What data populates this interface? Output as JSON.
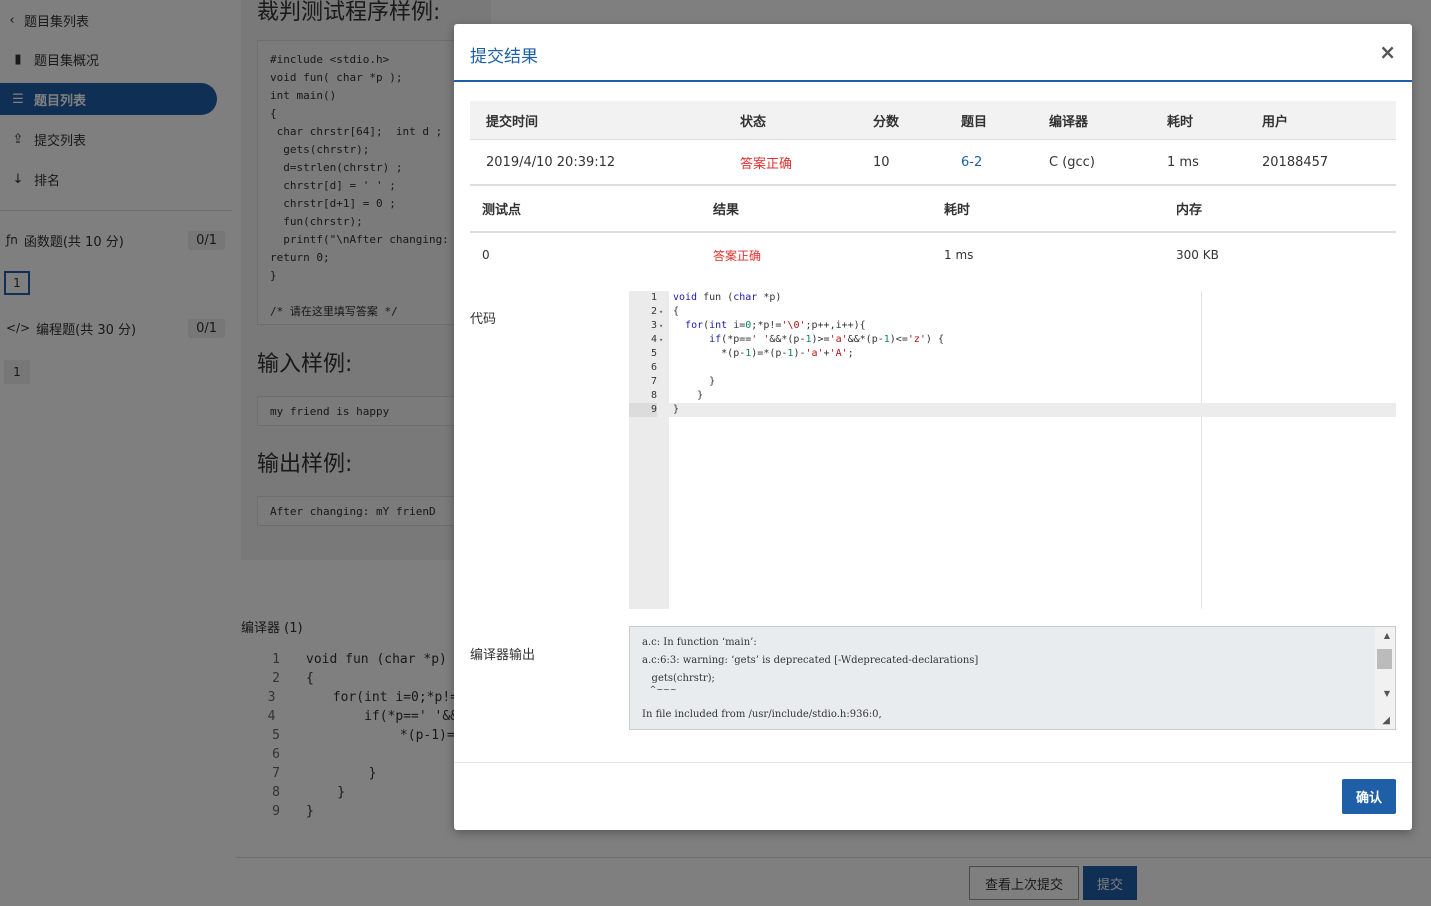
{
  "sidebar": {
    "back_label": "题目集列表",
    "items": [
      {
        "label": "题目集概况",
        "icon": "book-icon"
      },
      {
        "label": "题目列表",
        "icon": "list-icon"
      },
      {
        "label": "提交列表",
        "icon": "upload-icon"
      },
      {
        "label": "排名",
        "icon": "sort-icon"
      }
    ],
    "sections": [
      {
        "label": "函数题(共 10 分)",
        "score": "0/1",
        "questions": [
          "1"
        ]
      },
      {
        "label": "编程题(共 30 分)",
        "score": "0/1",
        "questions": [
          "1"
        ]
      }
    ]
  },
  "problem": {
    "judge_title": "裁判测试程序样例:",
    "judge_code": "#include <stdio.h>\nvoid fun( char *p );\nint main()\n{\n char chrstr[64];  int d ;\n  gets(chrstr);\n  d=strlen(chrstr) ;\n  chrstr[d] = ' ' ;\n  chrstr[d+1] = 0 ;\n  fun(chrstr);\n  printf(\"\\nAfter changing:\nreturn 0;\n}\n\n/* 请在这里填写答案 */",
    "input_title": "输入样例:",
    "input_sample": "my friend is happy",
    "output_title": "输出样例:",
    "output_sample": "After changing:   mY frienD"
  },
  "editor": {
    "label": "编译器 (1)",
    "lines": [
      {
        "n": "1",
        "t": "void fun (char *p)"
      },
      {
        "n": "2",
        "t": "{"
      },
      {
        "n": "3",
        "t": "    for(int i=0;*p!="
      },
      {
        "n": "4",
        "t": "        if(*p==' '&&"
      },
      {
        "n": "5",
        "t": "            *(p-1)="
      },
      {
        "n": "6",
        "t": ""
      },
      {
        "n": "7",
        "t": "        }"
      },
      {
        "n": "8",
        "t": "    }"
      },
      {
        "n": "9",
        "t": "}"
      }
    ]
  },
  "bottom": {
    "last_submit_label": "查看上次提交",
    "submit_label": "提交"
  },
  "modal": {
    "title": "提交结果",
    "close": "×",
    "summary_headers": [
      "提交时间",
      "状态",
      "分数",
      "题目",
      "编译器",
      "耗时",
      "用户"
    ],
    "summary_row": [
      "2019/4/10 20:39:12",
      "答案正确",
      "10",
      "6-2",
      "C (gcc)",
      "1 ms",
      "20188457"
    ],
    "test_headers": [
      "测试点",
      "结果",
      "耗时",
      "内存"
    ],
    "test_row": [
      "0",
      "答案正确",
      "1 ms",
      "300 KB"
    ],
    "code_label": "代码",
    "code_lines": [
      {
        "n": "1",
        "f": "",
        "t": "void fun (char *p)"
      },
      {
        "n": "2",
        "f": "▾",
        "t": "{"
      },
      {
        "n": "3",
        "f": "▾",
        "t": "  for(int i=0;*p!='\\0';p++,i++){"
      },
      {
        "n": "4",
        "f": "▾",
        "t": "      if(*p==' '&&*(p-1)>='a'&&*(p-1)<='z') {"
      },
      {
        "n": "5",
        "f": "",
        "t": "        *(p-1)=*(p-1)-'a'+'A';"
      },
      {
        "n": "6",
        "f": "",
        "t": ""
      },
      {
        "n": "7",
        "f": "",
        "t": "      }"
      },
      {
        "n": "8",
        "f": "",
        "t": "    }"
      },
      {
        "n": "9",
        "f": "",
        "t": "}"
      }
    ],
    "compiler_label": "编译器输出",
    "compiler_lines": [
      "a.c: In function ‘main’:",
      "a.c:6:3: warning: ‘gets’ is deprecated [-Wdeprecated-declarations]",
      "   gets(chrstr);",
      "   ^~~~",
      "In file included from /usr/include/stdio.h:936:0,"
    ],
    "confirm_label": "确认"
  },
  "colors": {
    "primary": "#1f5fa8",
    "accepted": "#e03030",
    "link": "#1f5fa8"
  }
}
